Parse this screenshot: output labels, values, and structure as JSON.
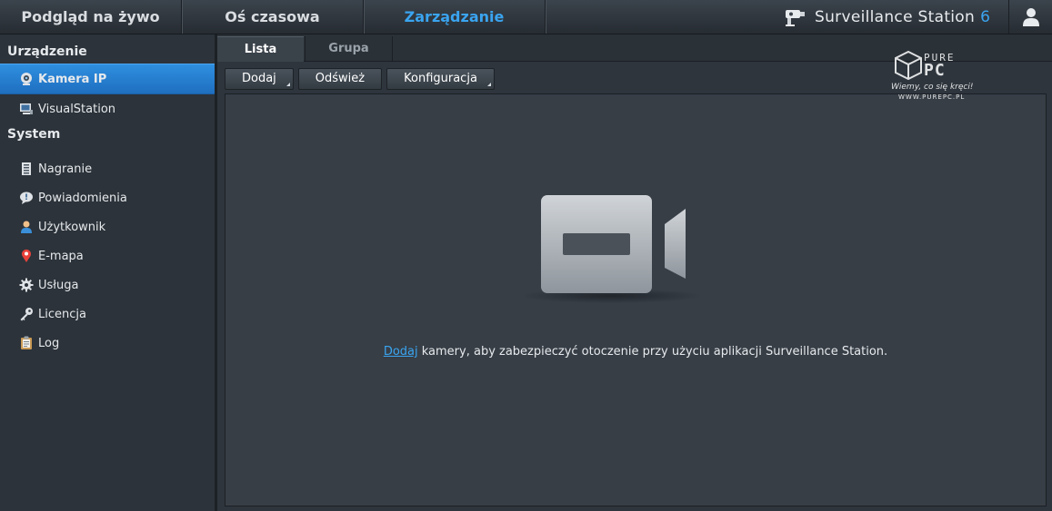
{
  "topnav": {
    "tabs": [
      {
        "label": "Podgląd na żywo",
        "active": false
      },
      {
        "label": "Oś czasowa",
        "active": false
      },
      {
        "label": "Zarządzanie",
        "active": true
      }
    ]
  },
  "brand": {
    "title": "Surveillance Station",
    "version": "6",
    "accent_color": "#3aa4f0"
  },
  "sidebar": {
    "sections": [
      {
        "heading": "Urządzenie",
        "items": [
          {
            "label": "Kamera IP",
            "icon": "webcam-icon",
            "active": true
          },
          {
            "label": "VisualStation",
            "icon": "monitor-icon",
            "active": false
          }
        ]
      },
      {
        "heading": "System",
        "items": [
          {
            "label": "Nagranie",
            "icon": "recording-list-icon"
          },
          {
            "label": "Powiadomienia",
            "icon": "notification-bubble-icon"
          },
          {
            "label": "Użytkownik",
            "icon": "user-icon"
          },
          {
            "label": "E-mapa",
            "icon": "map-pin-icon"
          },
          {
            "label": "Usługa",
            "icon": "gear-icon"
          },
          {
            "label": "Licencja",
            "icon": "key-icon"
          },
          {
            "label": "Log",
            "icon": "clipboard-icon"
          }
        ]
      }
    ]
  },
  "subtabs": [
    {
      "label": "Lista",
      "active": true
    },
    {
      "label": "Grupa",
      "active": false
    }
  ],
  "toolbar": {
    "add_label": "Dodaj",
    "refresh_label": "Odśwież",
    "config_label": "Konfiguracja"
  },
  "empty_state": {
    "link_text": "Dodaj",
    "message": " kamery, aby zabezpieczyć otoczenie przy użyciu aplikacji Surveillance Station."
  },
  "watermark": {
    "line1": "PURE",
    "line2": "PC",
    "slogan": "Wiemy, co się kręci!",
    "url": "WWW.PUREPC.PL"
  }
}
